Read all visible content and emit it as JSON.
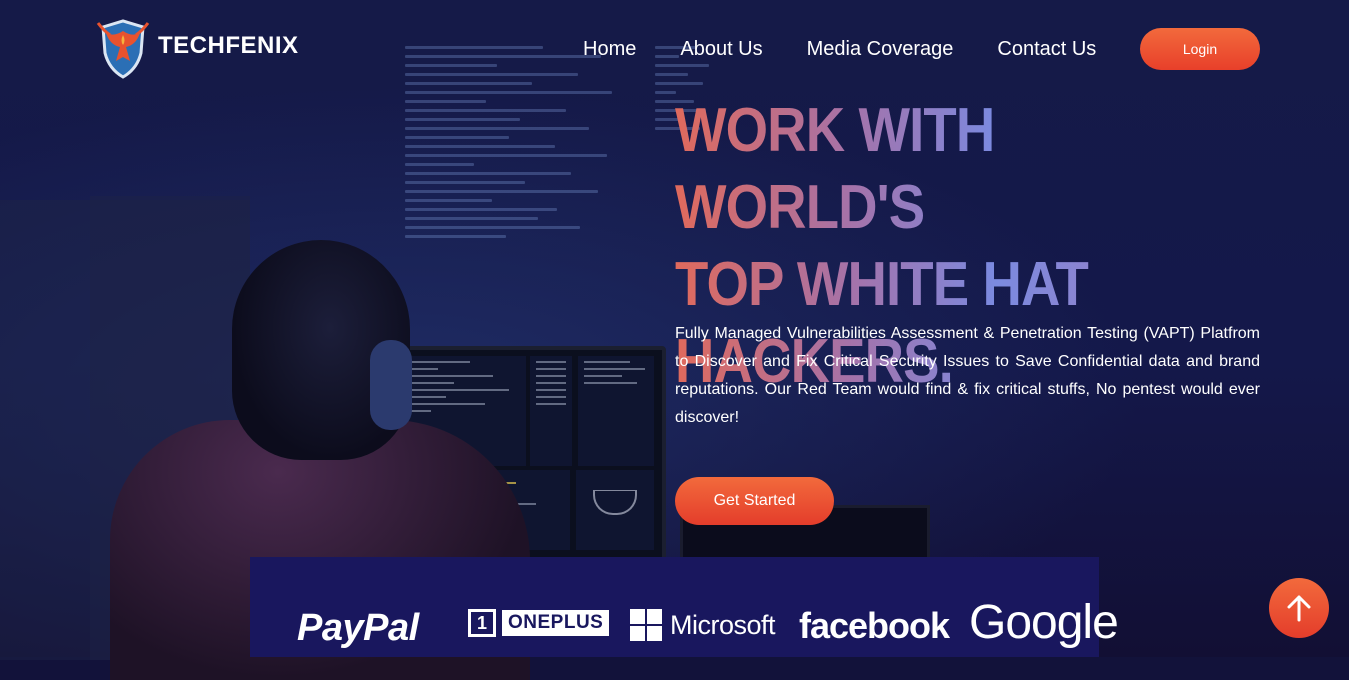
{
  "brand": {
    "name": "TECHFENIX",
    "logo_icon": "phoenix-shield-icon"
  },
  "nav": {
    "items": [
      {
        "label": "Home"
      },
      {
        "label": "About Us"
      },
      {
        "label": "Media Coverage"
      },
      {
        "label": "Contact Us"
      }
    ],
    "login_label": "Login"
  },
  "hero": {
    "headline_lines": [
      "WORK WITH WORLD'S",
      "TOP WHITE HAT",
      "HACKERS."
    ],
    "description": "Fully Managed Vulnerabilities Assessment & Penetration Testing (VAPT) Platfrom to Discover and Fix Critical Security Issues to Save Confidential data and brand reputations. Our Red Team would find & fix critical stuffs, No pentest would ever discover!",
    "cta_label": "Get Started"
  },
  "partners": {
    "paypal": "PayPal",
    "oneplus_mark": "1",
    "oneplus": "ONEPLUS",
    "microsoft": "Microsoft",
    "facebook": "facebook",
    "google": "Google"
  },
  "colors": {
    "accent": "#e8402a",
    "background": "#14184a",
    "partner_strip": "#19175e"
  },
  "icons": {
    "scroll_top": "arrow-up-icon"
  }
}
